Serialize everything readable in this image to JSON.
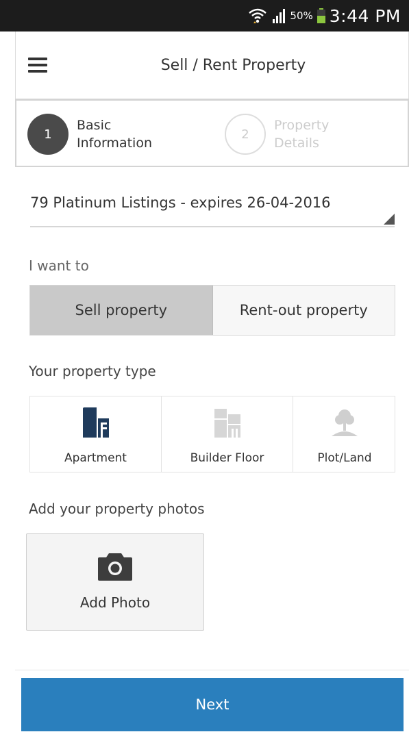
{
  "status_bar": {
    "battery_percent": "50%",
    "time": "3:44 PM",
    "icons": [
      "wifi-icon",
      "signal-icon",
      "battery-icon"
    ]
  },
  "header": {
    "title": "Sell / Rent Property",
    "menu_icon": "hamburger-menu-icon"
  },
  "steps": [
    {
      "number": "1",
      "line1": "Basic",
      "line2": "Information",
      "state": "active"
    },
    {
      "number": "2",
      "line1": "Property",
      "line2": "Details",
      "state": "inactive"
    }
  ],
  "listing": {
    "selected": "79 Platinum Listings - expires 26-04-2016"
  },
  "intent": {
    "label": "I want to",
    "options": [
      {
        "label": "Sell property",
        "selected": true
      },
      {
        "label": "Rent-out property",
        "selected": false
      }
    ]
  },
  "property_type": {
    "label": "Your property type",
    "options": [
      {
        "label": "Apartment",
        "icon": "apartment-icon",
        "selected": true
      },
      {
        "label": "Builder Floor",
        "icon": "builder-floor-icon",
        "selected": false
      },
      {
        "label": "Plot/Land",
        "icon": "plot-land-icon",
        "selected": false
      }
    ]
  },
  "photos": {
    "label": "Add your property photos",
    "button_label": "Add Photo",
    "icon": "camera-icon"
  },
  "footer": {
    "next_label": "Next"
  },
  "colors": {
    "primary_button": "#2a7fbd",
    "active_step": "#4a4a4a",
    "selected_toggle": "#c9c9c9",
    "apartment_icon": "#1f3b5c"
  }
}
